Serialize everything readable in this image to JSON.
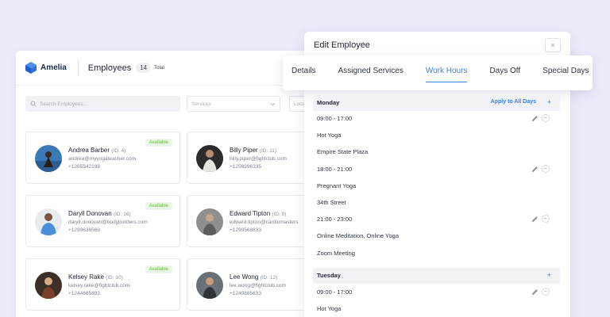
{
  "app": {
    "logo_text": "Amelia",
    "page_title": "Employees",
    "count": "14",
    "count_suffix": "Total",
    "search_placeholder": "Search Employees...",
    "services_placeholder": "Services",
    "location_placeholder": "Loca"
  },
  "employees": [
    {
      "name": "Andrea Barber",
      "id": "(ID: 4)",
      "email": "andrea@myyogateacher.com",
      "phone": "+1265542198",
      "badge": "Available"
    },
    {
      "name": "Billy Piper",
      "id": "(ID: 11)",
      "email": "billy.piper@fightclub.com",
      "phone": "+1256996335",
      "badge": ""
    },
    {
      "name": "Daryll Donovan",
      "id": "(ID: 16)",
      "email": "daryll.donovan@bodybuilders.com",
      "phone": "+1299636569",
      "badge": "Available"
    },
    {
      "name": "Edward Tipton",
      "id": "(ID: 9)",
      "email": "edward.tipton@cardiomasters",
      "phone": "+1299568833",
      "badge": ""
    },
    {
      "name": "Kelsey Rake",
      "id": "(ID: 10)",
      "email": "kelsey.rake@fightclub.com",
      "phone": "+1244665893",
      "badge": "Available"
    },
    {
      "name": "Lee Wong",
      "id": "(ID: 12)",
      "email": "lee.wong@fightclub.com",
      "phone": "+1249885633",
      "badge": ""
    }
  ],
  "modal": {
    "title": "Edit Employee",
    "close_label": "×",
    "tabs": [
      "Details",
      "Assigned Services",
      "Work Hours",
      "Days Off",
      "Special Days"
    ],
    "active_tab": "Work Hours",
    "apply_all_label": "Apply to All Days",
    "add_label": "+",
    "days": [
      {
        "name": "Monday",
        "periods": [
          {
            "time": "09:00 - 17:00",
            "service": "Hot Yoga",
            "location": "Empire State Plaza"
          },
          {
            "time": "18:00 - 21:00",
            "service": "Pregnant Yoga",
            "location": "34th Street"
          },
          {
            "time": "21:00 - 23:00",
            "service": "Online Meditation, Online Yoga",
            "location": "Zoom Meeting"
          }
        ]
      },
      {
        "name": "Tuesday",
        "periods": [
          {
            "time": "09:00 - 17:00",
            "service": "Hot Yoga",
            "location": ""
          }
        ]
      }
    ]
  },
  "colors": {
    "accent": "#3b82e6",
    "available": "#5fb83c",
    "background": "#efeafa"
  }
}
